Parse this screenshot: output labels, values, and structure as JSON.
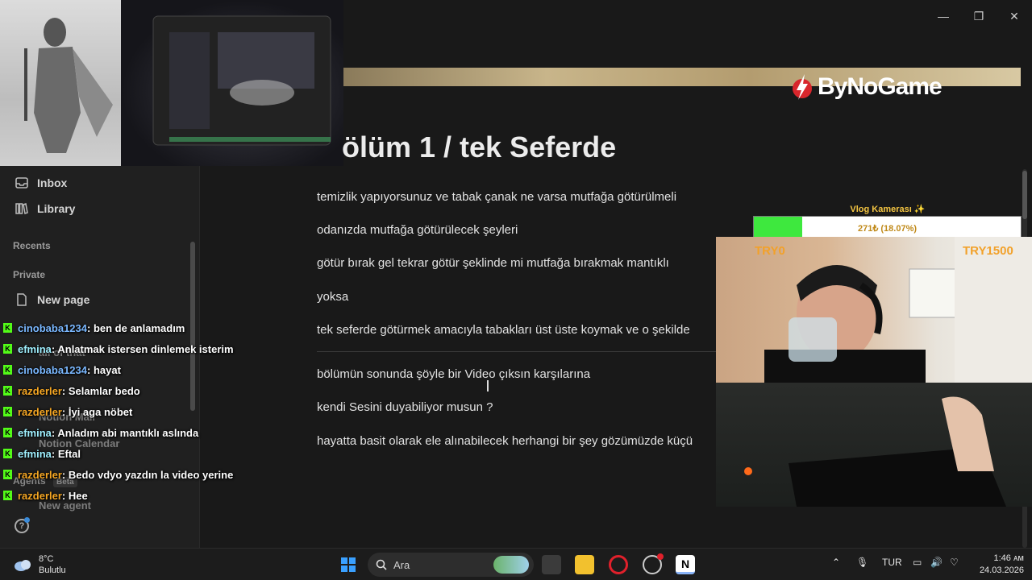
{
  "window": {
    "minimize": "—",
    "maximize": "❐",
    "close": "✕"
  },
  "sidebar": {
    "items": [
      {
        "label": "Inbox",
        "icon": "inbox-icon"
      },
      {
        "label": "Library",
        "icon": "library-icon"
      }
    ],
    "recents_label": "Recents",
    "private_label": "Private",
    "new_page_label": "New page",
    "ghost_items": [
      "all of that",
      "Notion Mail",
      "Notion Calendar",
      "New agent"
    ],
    "agents_label": "Agents",
    "agents_badge": "Beta",
    "help": "?"
  },
  "banner": {
    "logo_text": "ByNoGame"
  },
  "page": {
    "title": "ölüm 1 / tek Seferde",
    "paragraphs": [
      "temizlik yapıyorsunuz ve tabak çanak ne varsa mutfağa götürülmeli",
      "odanızda mutfağa götürülecek şeyleri",
      "götür bırak gel tekrar götür şeklinde mi mutfağa bırakmak mantıklı",
      "yoksa",
      "tek seferde götürmek amacıyla tabakları üst üste koymak ve o şekilde",
      "bölümün sonunda şöyle bir Video çıksın karşılarına",
      "kendi Sesini duyabiliyor musun ?",
      "hayatta basit olarak ele alınabilecek herhangi bir şey gözümüzde küçü"
    ]
  },
  "vlog": {
    "label": "Vlog Kamerası ✨",
    "progress_text": "271₺ (18.07%)",
    "progress_fraction": 0.1807,
    "left_label": "TRY0",
    "right_label": "TRY1500"
  },
  "chat": [
    {
      "user": "cinobaba1234",
      "msg": ": ben de anlamadım",
      "color": "#7ab8ff"
    },
    {
      "user": "efmina",
      "msg": ": Anlatmak istersen dinlemek isterim",
      "color": "#9ff0ff"
    },
    {
      "user": "cinobaba1234",
      "msg": ": hayat",
      "color": "#7ab8ff"
    },
    {
      "user": "razderler",
      "msg": ": Selamlar bedo",
      "color": "#f5a623"
    },
    {
      "user": "razderler",
      "msg": ": İyi aga nöbet",
      "color": "#f5a623"
    },
    {
      "user": "efmina",
      "msg": ": Anladım abi mantıklı aslında",
      "color": "#9ff0ff"
    },
    {
      "user": "efmina",
      "msg": ": Eftal",
      "color": "#9ff0ff"
    },
    {
      "user": "razderler",
      "msg": ": Bedo vdyo yazdın la video yerine",
      "color": "#f5a623"
    },
    {
      "user": "razderler",
      "msg": ": Hee",
      "color": "#f5a623"
    }
  ],
  "taskbar": {
    "weather_temp": "8°C",
    "weather_desc": "Bulutlu",
    "search_placeholder": "Ara",
    "lang": "TUR",
    "time": "1:46 ᴀᴍ",
    "date": "24.03.2026"
  }
}
